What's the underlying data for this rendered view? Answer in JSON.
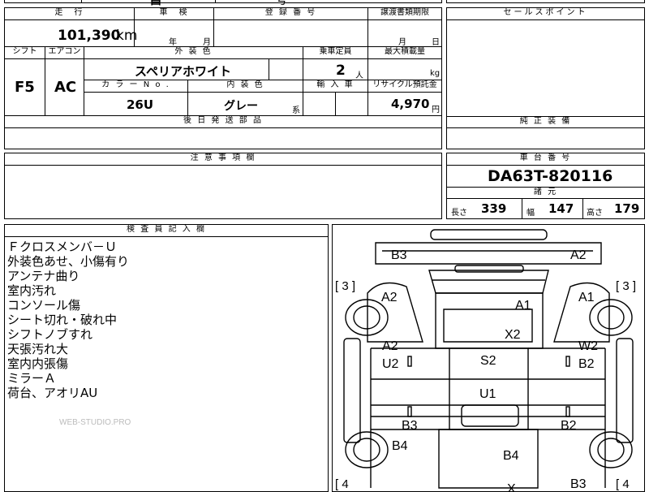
{
  "top_partial": {
    "cut_text_1": "昌",
    "cut_text_2": "号"
  },
  "header": {
    "mileage_label": "走　行",
    "mileage_value": "101,390",
    "mileage_unit": "km",
    "inspection_label": "車　検",
    "inspection_year": "年",
    "inspection_month": "月",
    "registration_label": "登 録 番 号",
    "transfer_label": "譲渡書類期限",
    "transfer_month": "月",
    "transfer_day": "日",
    "shift_label": "シフト",
    "aircon_label": "エアコン",
    "exterior_color_label": "外 装 色",
    "exterior_color_value": "スペリアホワイト",
    "capacity_label": "乗車定員",
    "capacity_value": "2",
    "capacity_unit": "人",
    "max_load_label": "最大積載量",
    "max_load_unit": "kg",
    "shift_value": "F5",
    "aircon_value": "AC",
    "color_no_label": "カ ラ ー N o .",
    "color_no_value": "26U",
    "interior_color_label": "内 装 色",
    "interior_color_value": "グレー",
    "interior_suffix": "系",
    "import_label": "輸 入 車",
    "recycle_label": "リサイクル預託金",
    "recycle_value": "4,970",
    "recycle_unit": "円",
    "later_parts_label": "後 日 発 送 部 品"
  },
  "sales_point_label": "セールスポイント",
  "genuine_equipment_label": "純 正 装 備",
  "notes_label": "注 意 事 項 欄",
  "chassis": {
    "label": "車 台 番 号",
    "value": "DA63T-820116",
    "spec_label": "諸 元",
    "length_label": "長さ",
    "length_value": "339",
    "width_label": "幅",
    "width_value": "147",
    "height_label": "高さ",
    "height_value": "179"
  },
  "inspector": {
    "label": "検 査 員 記 入 欄",
    "lines": [
      "Ｆクロスメンバ－Ｕ",
      "外装色あせ、小傷有り",
      "アンテナ曲り",
      "室内汚れ",
      "コンソール傷",
      "シート切れ・破れ中",
      "シフトノブすれ",
      "天張汚れ大",
      "室内内張傷",
      "ミラーＡ",
      "荷台、アオリAU"
    ],
    "watermark": "WEB-STUDIO.PRO"
  },
  "diagram": {
    "marks": [
      "B3",
      "A2",
      "A2",
      "A1",
      "A1",
      "X2",
      "A2",
      "W2",
      "U2",
      "S2",
      "B2",
      "U1",
      "B3",
      "B2",
      "B4",
      "B4",
      "B3",
      "X"
    ],
    "brackets": [
      "[ 3 ]",
      "[ 3 ]",
      "[ 4",
      "[ 4"
    ]
  }
}
